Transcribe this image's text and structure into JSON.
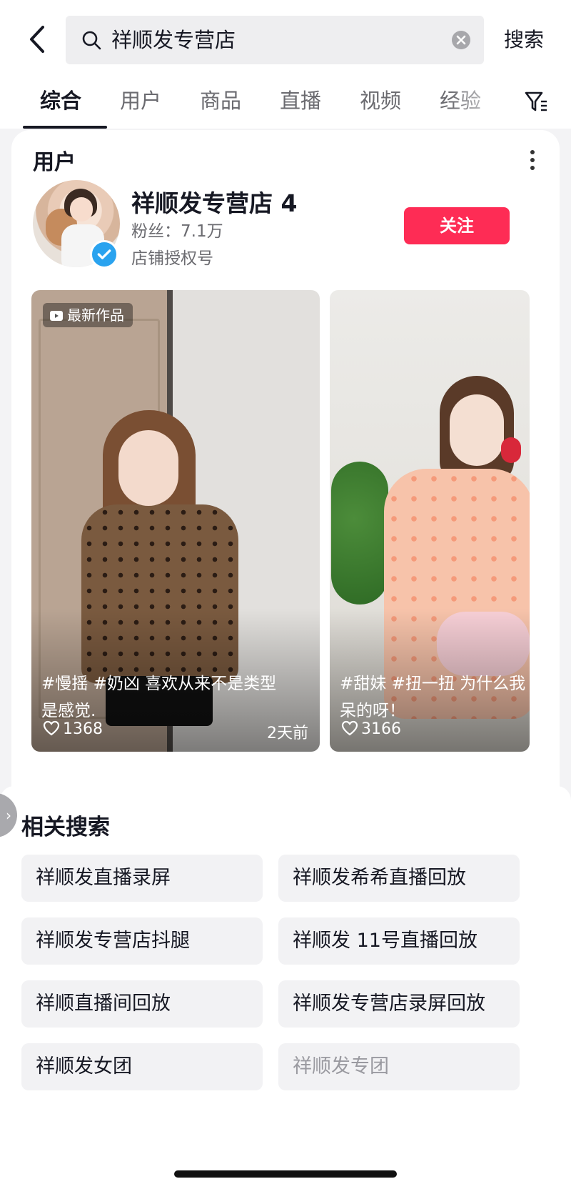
{
  "search": {
    "query": "祥顺发专营店",
    "button_label": "搜索"
  },
  "tabs": [
    {
      "label": "综合",
      "active": true
    },
    {
      "label": "用户",
      "active": false
    },
    {
      "label": "商品",
      "active": false
    },
    {
      "label": "直播",
      "active": false
    },
    {
      "label": "视频",
      "active": false
    },
    {
      "label": "经验",
      "active": false
    }
  ],
  "user_card": {
    "section_title": "用户",
    "name": "祥顺发专营店 4",
    "fans": "粉丝：7.1万",
    "account_type": "店铺授权号",
    "follow_label": "关注",
    "verified": true
  },
  "videos": [
    {
      "badge": "最新作品",
      "caption_line1": "#慢摇 #奶凶 喜欢从来不是类型",
      "caption_line2": "是感觉.",
      "likes": "1368",
      "time": "2天前"
    },
    {
      "caption_line1": "#甜妹 #扭一扭 为什么我",
      "caption_line2": "呆的呀！",
      "likes": "3166"
    }
  ],
  "related": {
    "title": "相关搜索",
    "items": [
      "祥顺发直播录屏",
      "祥顺发希希直播回放",
      "祥顺发专营店抖腿",
      "祥顺发 11号直播回放",
      "祥顺直播间回放",
      "祥顺发专营店录屏回放",
      "祥顺发女团",
      "祥顺发专团"
    ]
  },
  "colors": {
    "accent": "#fe2c55",
    "verified": "#2aa3ef",
    "text": "#161823",
    "secondary_text": "#6b6b70"
  },
  "icons": [
    "back-arrow-icon",
    "search-icon",
    "clear-icon",
    "filter-icon",
    "more-icon",
    "verified-icon",
    "video-badge-icon",
    "heart-icon",
    "chevron-right-icon"
  ]
}
